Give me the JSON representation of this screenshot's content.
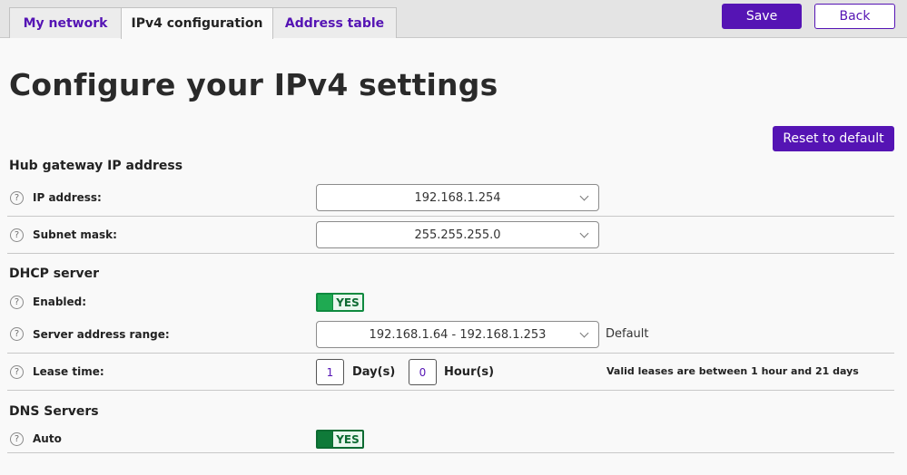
{
  "tabs": [
    {
      "label": "My network"
    },
    {
      "label": "IPv4 configuration"
    },
    {
      "label": "Address table"
    }
  ],
  "toolbar": {
    "save_label": "Save",
    "back_label": "Back"
  },
  "page_title": "Configure your IPv4 settings",
  "reset_label": "Reset to default",
  "help_glyph": "?",
  "sections": {
    "gateway": {
      "title": "Hub gateway IP address",
      "ip_label": "IP address:",
      "ip_value": "192.168.1.254",
      "subnet_label": "Subnet mask:",
      "subnet_value": "255.255.255.0"
    },
    "dhcp": {
      "title": "DHCP server",
      "enabled_label": "Enabled:",
      "enabled_value": "YES",
      "range_label": "Server address range:",
      "range_value": "192.168.1.64 - 192.168.1.253",
      "range_note": "Default",
      "lease_label": "Lease time:",
      "lease_days": "1",
      "days_unit": "Day(s)",
      "lease_hours": "0",
      "hours_unit": "Hour(s)",
      "lease_note": "Valid leases are between 1 hour and 21 days"
    },
    "dns": {
      "title": "DNS Servers",
      "auto_label": "Auto",
      "auto_value": "YES"
    }
  },
  "colors": {
    "accent": "#5514b4",
    "toggle_on": "#0f8a3f"
  }
}
